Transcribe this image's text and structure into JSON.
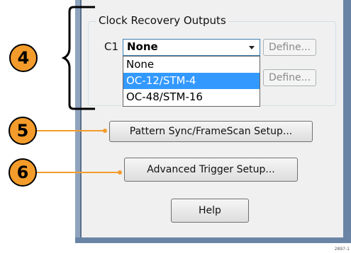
{
  "group": {
    "title": "Clock Recovery Outputs"
  },
  "row": {
    "label": "C1",
    "selected": "None",
    "define_label": "Define..."
  },
  "dropdown": {
    "options": [
      "None",
      "OC-12/STM-4",
      "OC-48/STM-16"
    ],
    "highlighted": "OC-12/STM-4"
  },
  "row2": {
    "define_label": "Define..."
  },
  "buttons": {
    "pattern_sync": "Pattern Sync/FrameScan Setup...",
    "advanced_trigger": "Advanced Trigger Setup...",
    "help": "Help"
  },
  "callouts": [
    "4",
    "5",
    "6"
  ],
  "caption": "2897-1",
  "colors": {
    "callout": "#f39c2b",
    "highlight": "#3399ff",
    "window_frame": "#6a84a6"
  }
}
